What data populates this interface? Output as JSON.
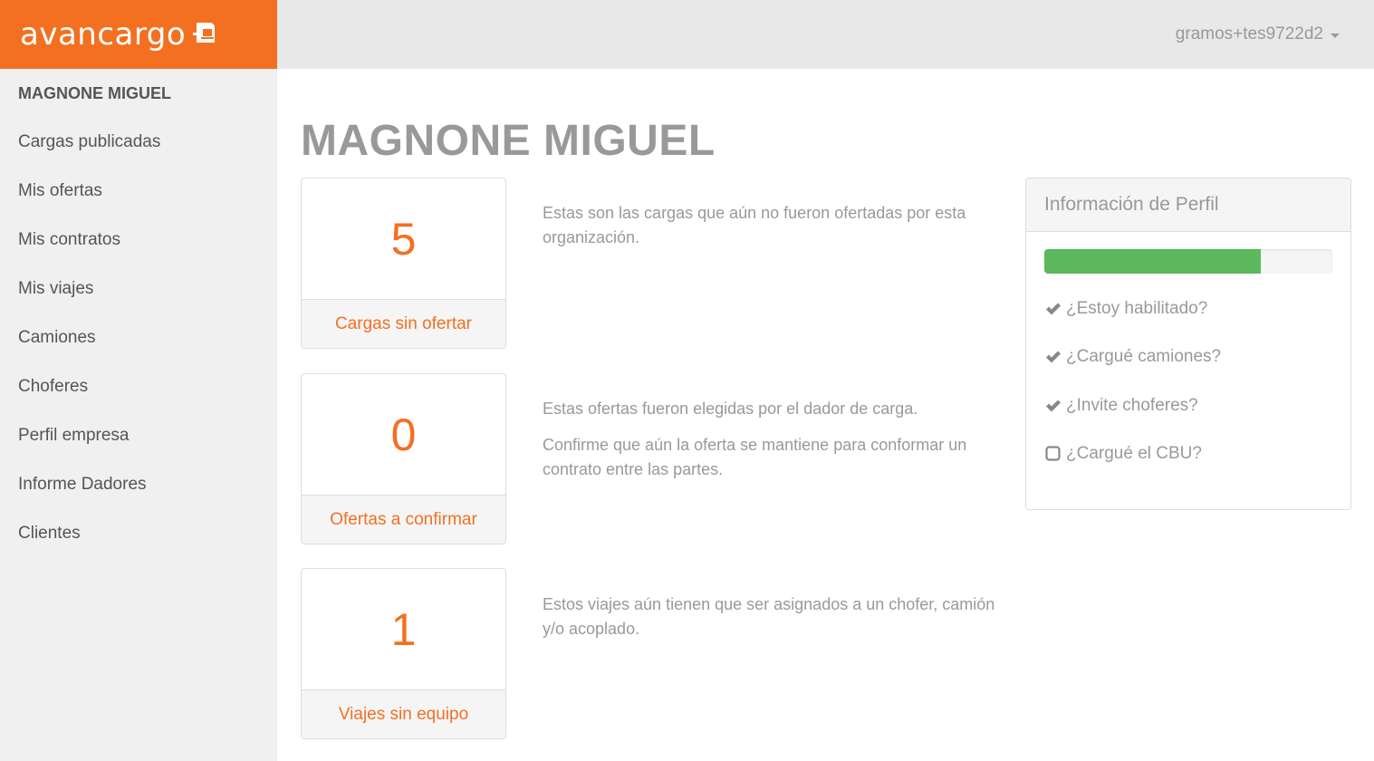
{
  "brand": {
    "name": "avancargo"
  },
  "header": {
    "user": "gramos+tes9722d2"
  },
  "sidebar": {
    "title": "MAGNONE MIGUEL",
    "items": [
      {
        "label": "Cargas publicadas"
      },
      {
        "label": "Mis ofertas"
      },
      {
        "label": "Mis contratos"
      },
      {
        "label": "Mis viajes"
      },
      {
        "label": "Camiones"
      },
      {
        "label": "Choferes"
      },
      {
        "label": "Perfil empresa"
      },
      {
        "label": "Informe Dadores"
      },
      {
        "label": "Clientes"
      }
    ]
  },
  "main": {
    "title": "MAGNONE MIGUEL",
    "stats": [
      {
        "value": "5",
        "label": "Cargas sin ofertar",
        "description": [
          "Estas son las cargas que aún no fueron ofertadas por esta organización."
        ]
      },
      {
        "value": "0",
        "label": "Ofertas a confirmar",
        "description": [
          "Estas ofertas fueron elegidas por el dador de carga.",
          "Confirme que aún la oferta se mantiene para conformar un contrato entre las partes."
        ]
      },
      {
        "value": "1",
        "label": "Viajes sin equipo",
        "description": [
          "Estos viajes aún tienen que ser asignados a un chofer, camión y/o acoplado."
        ]
      }
    ]
  },
  "profile_panel": {
    "title": "Información de Perfil",
    "progress_fraction": 0.75,
    "checks": [
      {
        "label": "¿Estoy habilitado?",
        "checked": true
      },
      {
        "label": "¿Cargué camiones?",
        "checked": true
      },
      {
        "label": "¿Invite choferes?",
        "checked": true
      },
      {
        "label": "¿Cargué el CBU?",
        "checked": false
      }
    ]
  },
  "colors": {
    "brand": "#f37021",
    "progress": "#5cb85c",
    "sidebar_bg": "#f0f0f0",
    "topbar_bg": "#e8e8e8"
  }
}
